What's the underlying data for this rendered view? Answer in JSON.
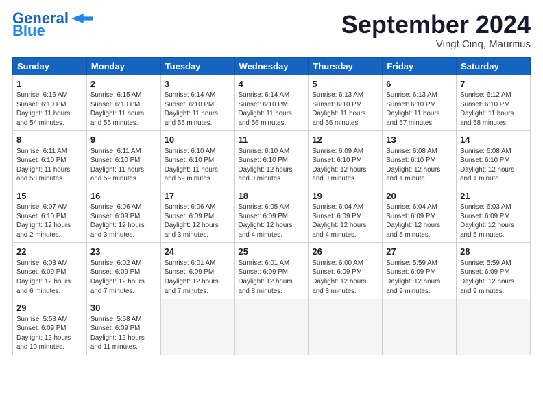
{
  "logo": {
    "line1": "General",
    "line2": "Blue",
    "arrow_color": "#1e88e5"
  },
  "title": "September 2024",
  "location": "Vingt Cinq, Mauritius",
  "headers": [
    "Sunday",
    "Monday",
    "Tuesday",
    "Wednesday",
    "Thursday",
    "Friday",
    "Saturday"
  ],
  "weeks": [
    [
      {
        "day": "1",
        "info": "Sunrise: 6:16 AM\nSunset: 6:10 PM\nDaylight: 11 hours\nand 54 minutes."
      },
      {
        "day": "2",
        "info": "Sunrise: 6:15 AM\nSunset: 6:10 PM\nDaylight: 11 hours\nand 55 minutes."
      },
      {
        "day": "3",
        "info": "Sunrise: 6:14 AM\nSunset: 6:10 PM\nDaylight: 11 hours\nand 55 minutes."
      },
      {
        "day": "4",
        "info": "Sunrise: 6:14 AM\nSunset: 6:10 PM\nDaylight: 11 hours\nand 56 minutes."
      },
      {
        "day": "5",
        "info": "Sunrise: 6:13 AM\nSunset: 6:10 PM\nDaylight: 11 hours\nand 56 minutes."
      },
      {
        "day": "6",
        "info": "Sunrise: 6:13 AM\nSunset: 6:10 PM\nDaylight: 11 hours\nand 57 minutes."
      },
      {
        "day": "7",
        "info": "Sunrise: 6:12 AM\nSunset: 6:10 PM\nDaylight: 11 hours\nand 58 minutes."
      }
    ],
    [
      {
        "day": "8",
        "info": "Sunrise: 6:11 AM\nSunset: 6:10 PM\nDaylight: 11 hours\nand 58 minutes."
      },
      {
        "day": "9",
        "info": "Sunrise: 6:11 AM\nSunset: 6:10 PM\nDaylight: 11 hours\nand 59 minutes."
      },
      {
        "day": "10",
        "info": "Sunrise: 6:10 AM\nSunset: 6:10 PM\nDaylight: 11 hours\nand 59 minutes."
      },
      {
        "day": "11",
        "info": "Sunrise: 6:10 AM\nSunset: 6:10 PM\nDaylight: 12 hours\nand 0 minutes."
      },
      {
        "day": "12",
        "info": "Sunrise: 6:09 AM\nSunset: 6:10 PM\nDaylight: 12 hours\nand 0 minutes."
      },
      {
        "day": "13",
        "info": "Sunrise: 6:08 AM\nSunset: 6:10 PM\nDaylight: 12 hours\nand 1 minute."
      },
      {
        "day": "14",
        "info": "Sunrise: 6:08 AM\nSunset: 6:10 PM\nDaylight: 12 hours\nand 1 minute."
      }
    ],
    [
      {
        "day": "15",
        "info": "Sunrise: 6:07 AM\nSunset: 6:10 PM\nDaylight: 12 hours\nand 2 minutes."
      },
      {
        "day": "16",
        "info": "Sunrise: 6:06 AM\nSunset: 6:09 PM\nDaylight: 12 hours\nand 3 minutes."
      },
      {
        "day": "17",
        "info": "Sunrise: 6:06 AM\nSunset: 6:09 PM\nDaylight: 12 hours\nand 3 minutes."
      },
      {
        "day": "18",
        "info": "Sunrise: 6:05 AM\nSunset: 6:09 PM\nDaylight: 12 hours\nand 4 minutes."
      },
      {
        "day": "19",
        "info": "Sunrise: 6:04 AM\nSunset: 6:09 PM\nDaylight: 12 hours\nand 4 minutes."
      },
      {
        "day": "20",
        "info": "Sunrise: 6:04 AM\nSunset: 6:09 PM\nDaylight: 12 hours\nand 5 minutes."
      },
      {
        "day": "21",
        "info": "Sunrise: 6:03 AM\nSunset: 6:09 PM\nDaylight: 12 hours\nand 5 minutes."
      }
    ],
    [
      {
        "day": "22",
        "info": "Sunrise: 6:03 AM\nSunset: 6:09 PM\nDaylight: 12 hours\nand 6 minutes."
      },
      {
        "day": "23",
        "info": "Sunrise: 6:02 AM\nSunset: 6:09 PM\nDaylight: 12 hours\nand 7 minutes."
      },
      {
        "day": "24",
        "info": "Sunrise: 6:01 AM\nSunset: 6:09 PM\nDaylight: 12 hours\nand 7 minutes."
      },
      {
        "day": "25",
        "info": "Sunrise: 6:01 AM\nSunset: 6:09 PM\nDaylight: 12 hours\nand 8 minutes."
      },
      {
        "day": "26",
        "info": "Sunrise: 6:00 AM\nSunset: 6:09 PM\nDaylight: 12 hours\nand 8 minutes."
      },
      {
        "day": "27",
        "info": "Sunrise: 5:59 AM\nSunset: 6:09 PM\nDaylight: 12 hours\nand 9 minutes."
      },
      {
        "day": "28",
        "info": "Sunrise: 5:59 AM\nSunset: 6:09 PM\nDaylight: 12 hours\nand 9 minutes."
      }
    ],
    [
      {
        "day": "29",
        "info": "Sunrise: 5:58 AM\nSunset: 6:09 PM\nDaylight: 12 hours\nand 10 minutes."
      },
      {
        "day": "30",
        "info": "Sunrise: 5:58 AM\nSunset: 6:09 PM\nDaylight: 12 hours\nand 11 minutes."
      },
      {
        "day": "",
        "info": ""
      },
      {
        "day": "",
        "info": ""
      },
      {
        "day": "",
        "info": ""
      },
      {
        "day": "",
        "info": ""
      },
      {
        "day": "",
        "info": ""
      }
    ]
  ]
}
